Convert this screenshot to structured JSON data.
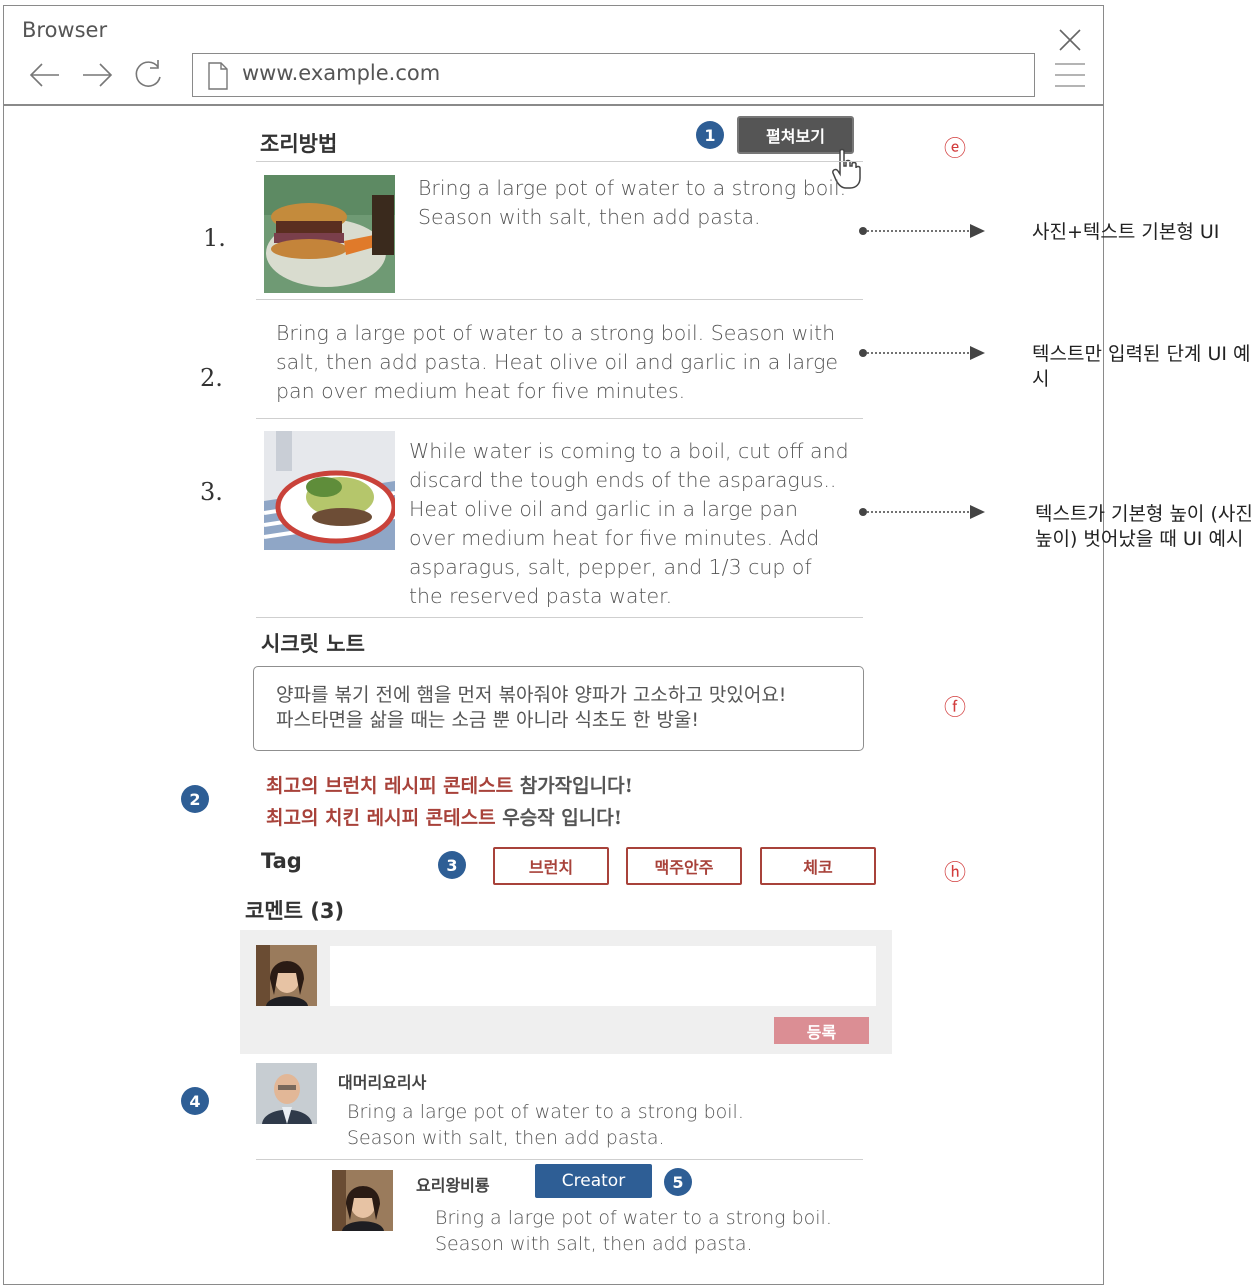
{
  "browser": {
    "title": "Browser",
    "url": "www.example.com"
  },
  "recipe": {
    "section_title": "조리방법",
    "expand_button": "펼쳐보기",
    "steps": [
      {
        "num": "1.",
        "text": "Bring a large pot of water to a strong boil. Season with salt, then add pasta."
      },
      {
        "num": "2.",
        "text": "Bring a large pot of water to a strong boil. Season with salt, then add pasta. Heat olive oil and garlic in a large pan over medium heat for five minutes."
      },
      {
        "num": "3.",
        "text": "While water is coming to a boil, cut off and discard the tough ends of the asparagus.. Heat olive oil and garlic in a large pan over medium heat for five minutes. Add asparagus, salt, pepper, and 1/3 cup of the reserved pasta water."
      }
    ]
  },
  "annotations": {
    "badge1": "1",
    "badge2": "2",
    "badge3": "3",
    "badge4": "4",
    "badge5": "5",
    "marker_e": "ⓔ",
    "marker_f": "ⓕ",
    "marker_h": "ⓗ",
    "notes": [
      "사진+텍스트 기본형 UI",
      "텍스트만 입력된 단계 UI 예시",
      "텍스트가 기본형 높이 (사진 높이) 벗어났을 때 UI 예시"
    ]
  },
  "secret_note": {
    "title": "시크릿 노트",
    "line1": "양파를 볶기 전에 햄을 먼저 볶아줘야 양파가 고소하고 맛있어요!",
    "line2": "파스타면을 삶을 때는 소금 뿐 아니라 식초도 한 방울!"
  },
  "contests": [
    {
      "highlight": "최고의 브런치 레시피 콘테스트",
      "rest": " 참가작입니다!"
    },
    {
      "highlight": "최고의 치킨 레시피 콘테스트",
      "rest": " 우승작 입니다!"
    }
  ],
  "tags": {
    "label": "Tag",
    "items": [
      "브런치",
      "맥주안주",
      "체코"
    ]
  },
  "comments": {
    "title": "코멘트 (3)",
    "submit_label": "등록",
    "list": [
      {
        "user": "대머리요리사",
        "line1": "Bring a large pot of water to a strong boil.",
        "line2": "Season with salt, then add pasta."
      },
      {
        "user": "요리왕비룡",
        "badge": "Creator",
        "line1": "Bring a large pot of water to a strong boil.",
        "line2": "Season with salt, then add pasta."
      }
    ]
  },
  "colors": {
    "accent_blue": "#2e5e95",
    "accent_red": "#a8423a",
    "submit_pink": "#db8e94"
  }
}
